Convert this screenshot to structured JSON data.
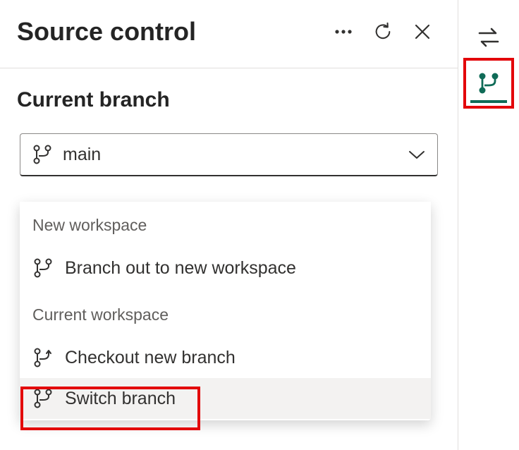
{
  "header": {
    "title": "Source control"
  },
  "section": {
    "label": "Current branch",
    "selected_branch": "main"
  },
  "dropdown": {
    "groups": [
      {
        "header": "New workspace",
        "items": [
          {
            "label": "Branch out to new workspace",
            "icon": "branch-icon"
          }
        ]
      },
      {
        "header": "Current workspace",
        "items": [
          {
            "label": "Checkout new branch",
            "icon": "checkout-icon"
          },
          {
            "label": "Switch branch",
            "icon": "switch-branch-icon"
          }
        ]
      }
    ]
  },
  "colors": {
    "highlight": "#e3060a",
    "brand_green": "#0f6b57"
  }
}
